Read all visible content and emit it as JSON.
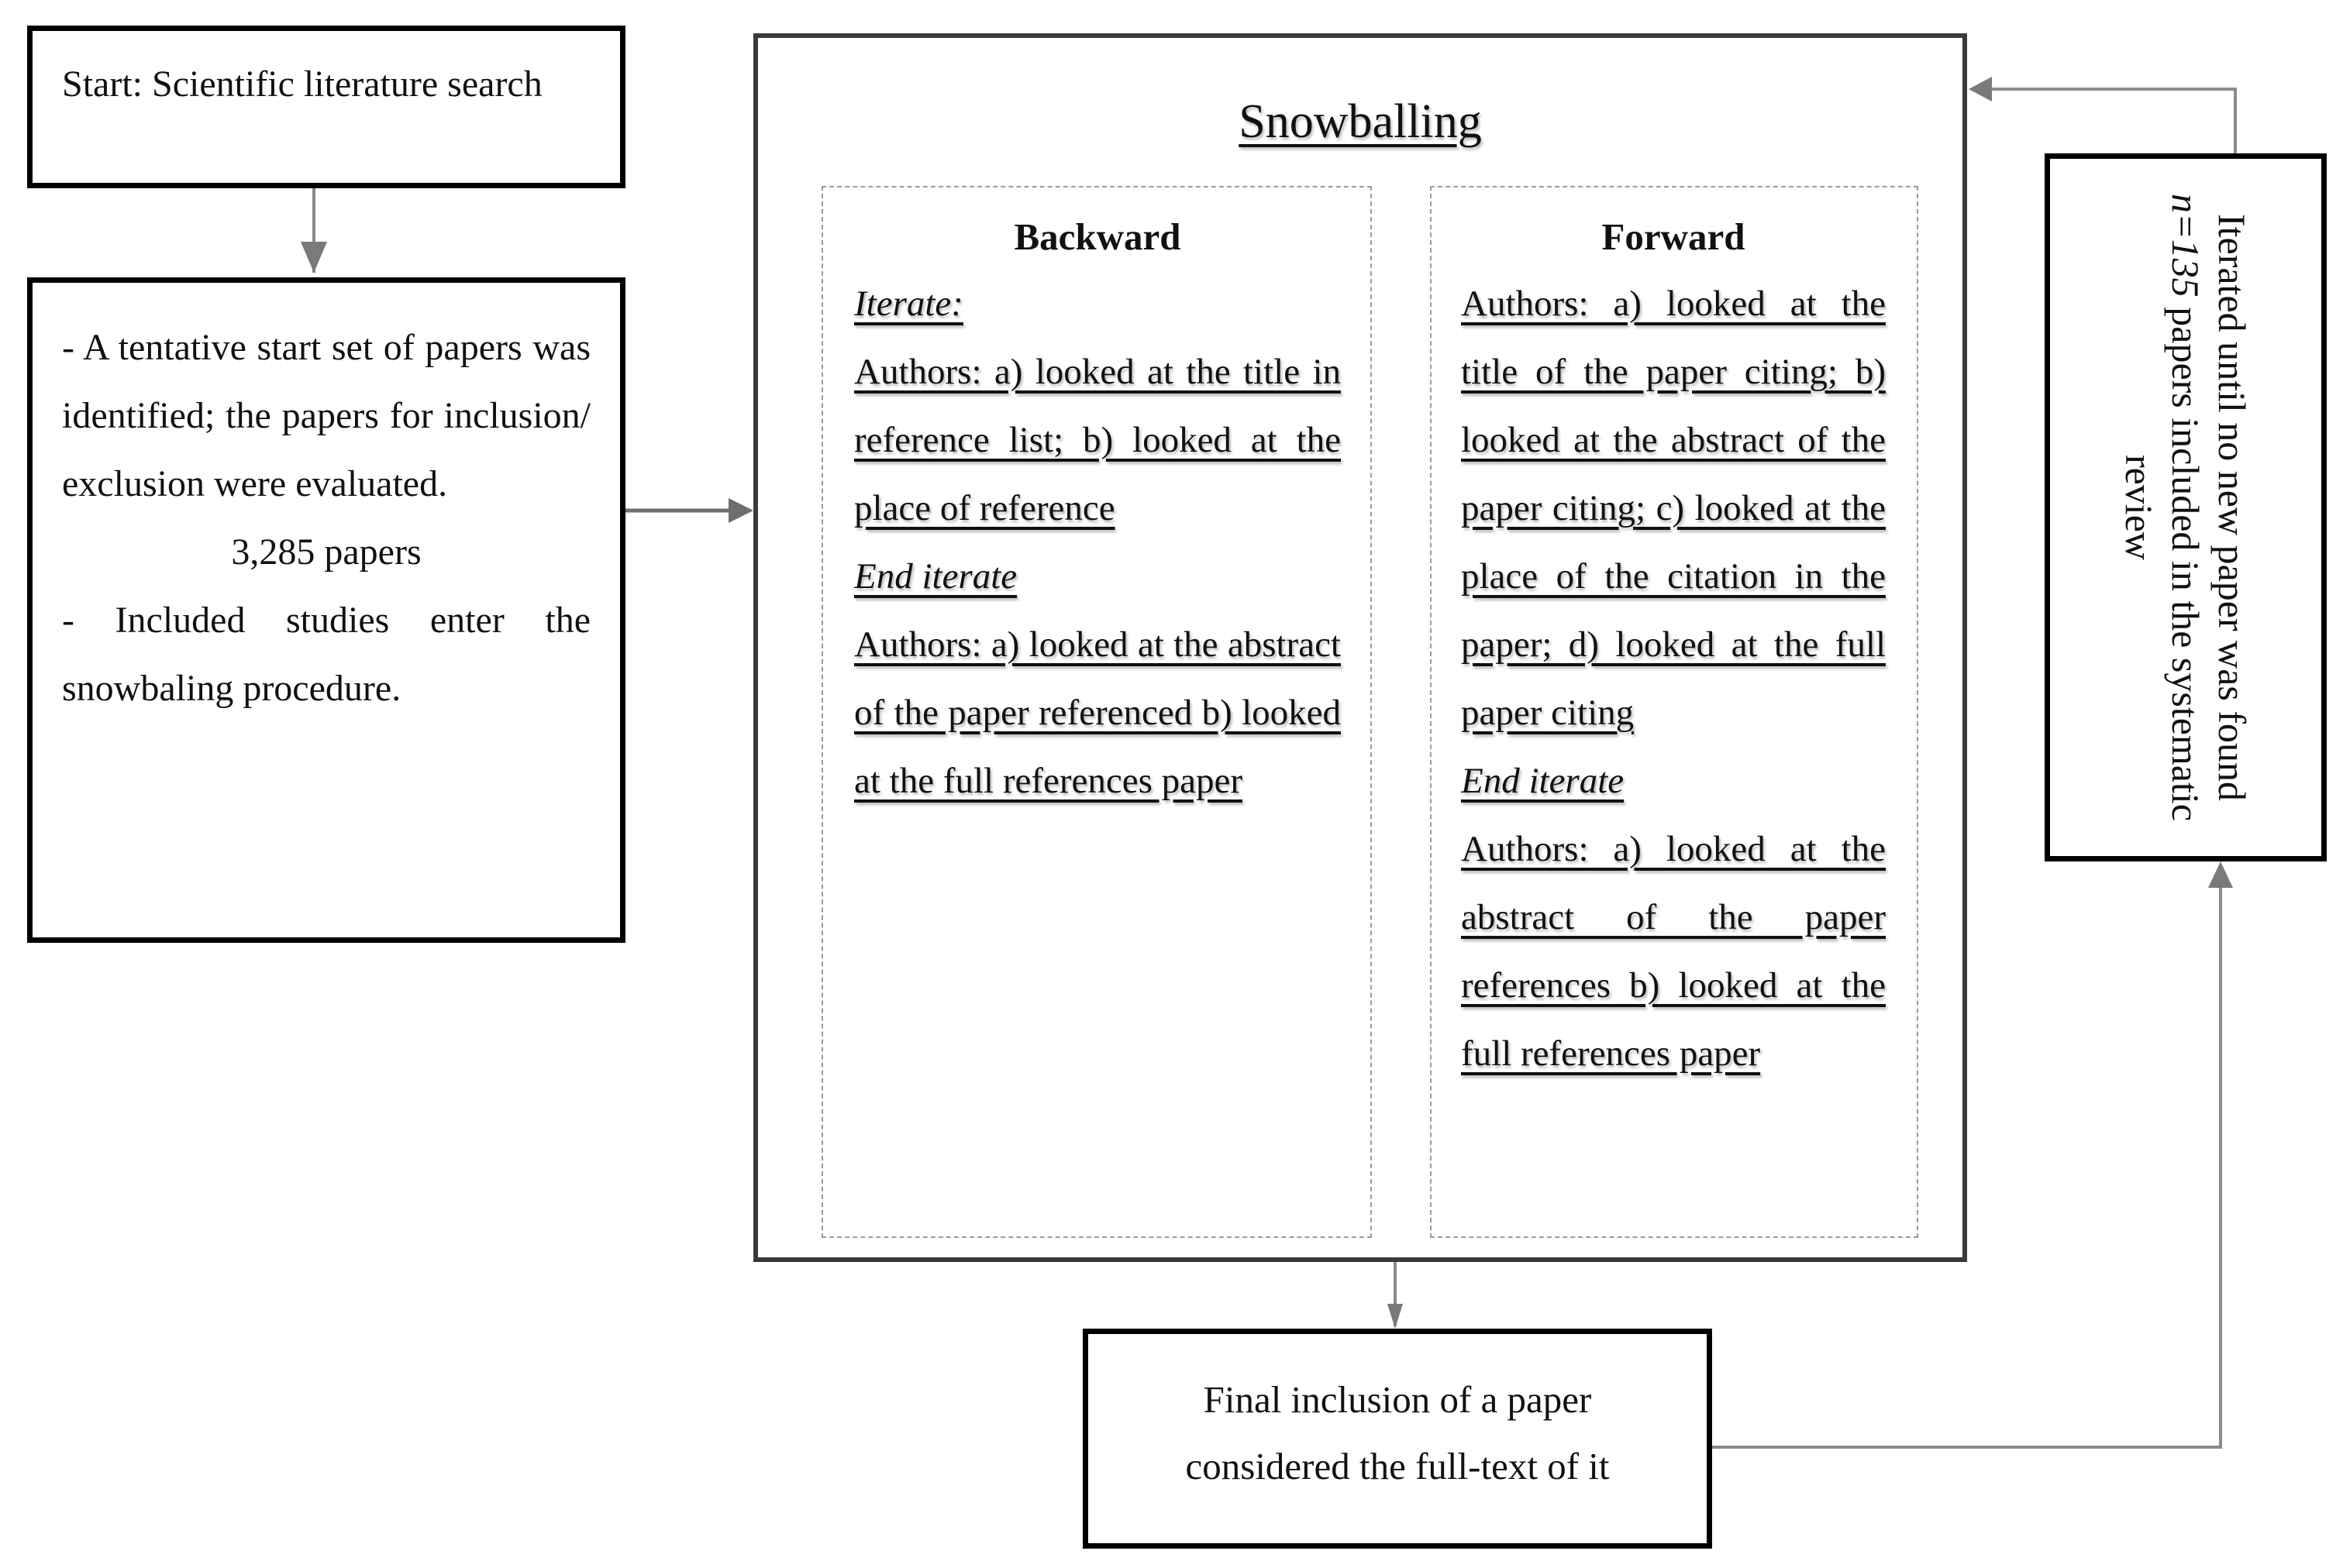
{
  "start_box": {
    "text": "Start: Scientific literature search"
  },
  "screening_box": {
    "line1": "- A tentative start set of papers was identified; the papers for inclusion/ exclusion were evaluated.",
    "count": "3,285 papers",
    "line2": "- Included studies enter the snowbaling procedure."
  },
  "snowballing": {
    "title": "Snowballing",
    "backward": {
      "heading": "Backward",
      "iterate_label": "Iterate:",
      "step1": "Authors: a) looked at the title in reference list; b) looked at the place of reference",
      "end_label": "End iterate",
      "step2": "Authors: a) looked at the abstract of the paper referenced b) looked at the full references paper"
    },
    "forward": {
      "heading": "Forward",
      "step1": "Authors: a) looked at the title of the paper citing; b) looked at the abstract of the paper citing; c) looked at the place of the citation in the paper; d) looked at the full paper citing",
      "end_label": "End iterate",
      "step2": "Authors: a) looked at the abstract of the paper references b) looked at the full references paper"
    }
  },
  "iteration_box": {
    "text_before": "Iterated until no new paper was found ",
    "n_value": "n=135",
    "text_after": " papers included in the systematic review"
  },
  "final_box": {
    "line1": "Final inclusion of a paper",
    "line2": "considered the full-text of it"
  },
  "colors": {
    "box_border": "#000000",
    "snowball_border": "#3a3a3a",
    "arrow": "#7f7f7f",
    "dashed_border": "#9a9a9a"
  }
}
